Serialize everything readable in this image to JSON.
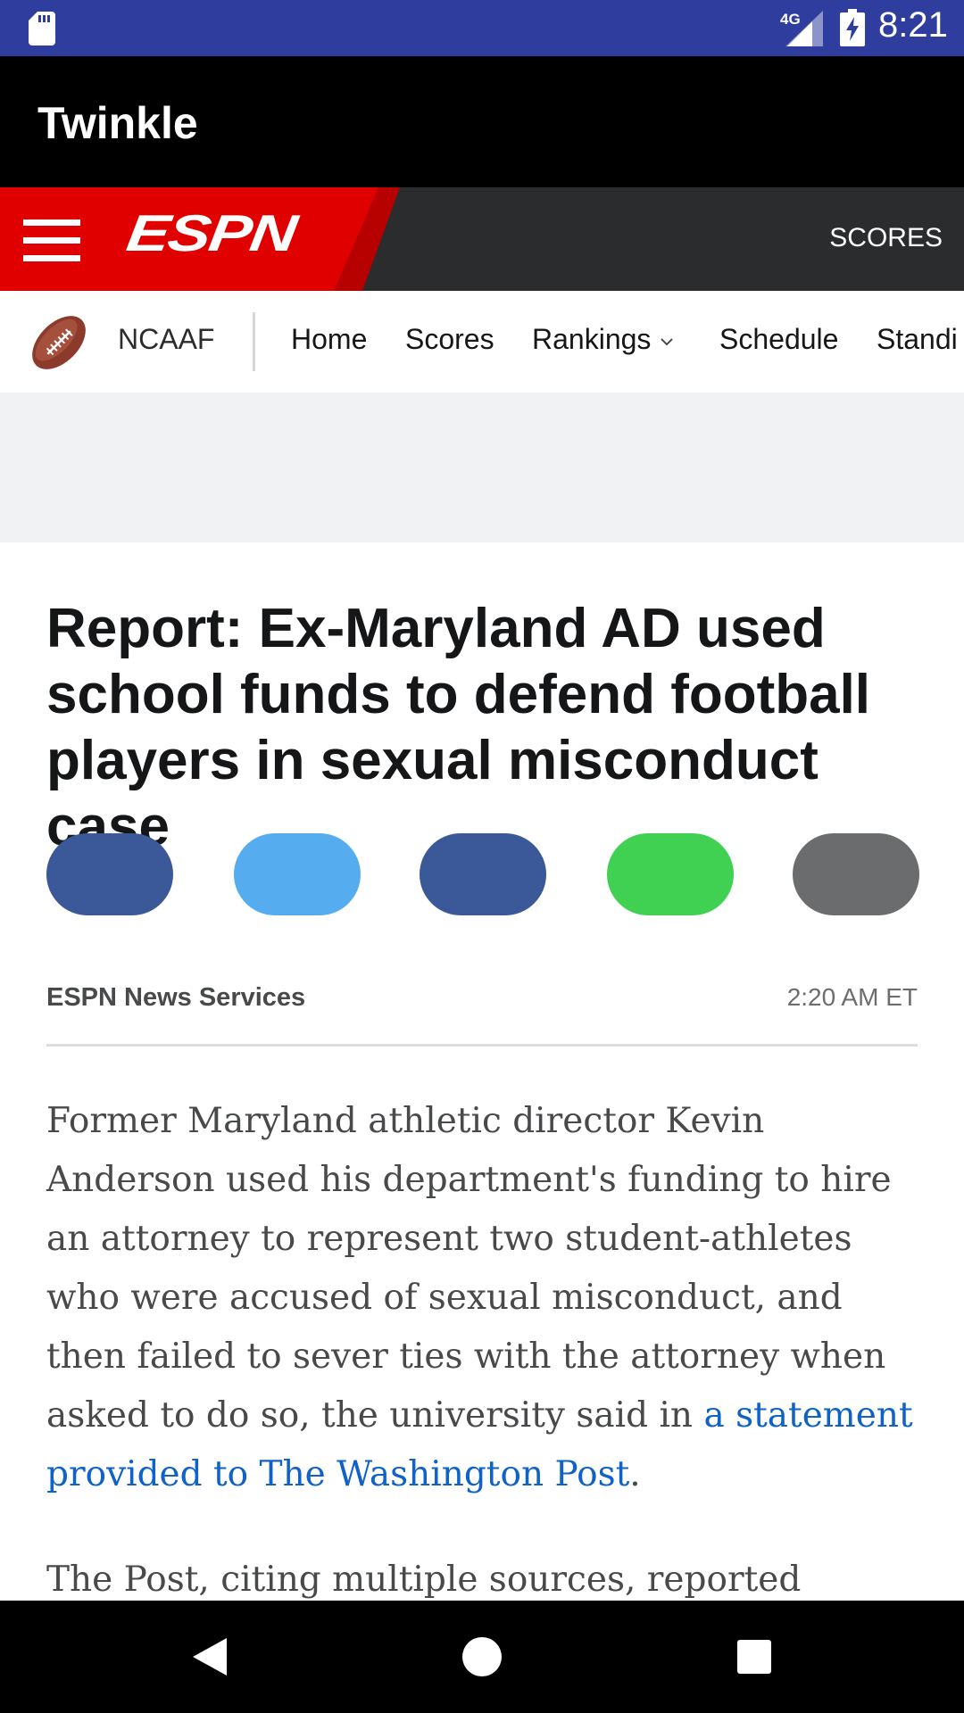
{
  "status_bar": {
    "network": "4G",
    "time": "8:21",
    "icons": [
      "sd-card-icon",
      "signal-icon",
      "battery-charging-icon"
    ]
  },
  "app_bar": {
    "title": "Twinkle"
  },
  "espn_header": {
    "logo_text": "ESPN",
    "scores_label": "SCORES",
    "colors": {
      "brand_red": "#e00000",
      "header_bg": "#2b2c2d"
    }
  },
  "sub_nav": {
    "sport": "NCAAF",
    "items": [
      {
        "label": "Home"
      },
      {
        "label": "Scores"
      },
      {
        "label": "Rankings",
        "has_dropdown": true
      },
      {
        "label": "Schedule"
      },
      {
        "label": "Standi"
      }
    ]
  },
  "article": {
    "headline": "Report: Ex-Maryland AD used school funds to defend football players in sexual misconduct case",
    "share_buttons": [
      {
        "name": "facebook",
        "color": "#3b5998"
      },
      {
        "name": "twitter",
        "color": "#55acee"
      },
      {
        "name": "messenger",
        "color": "#3b5998"
      },
      {
        "name": "sms",
        "color": "#40d152"
      },
      {
        "name": "email",
        "color": "#6b6c6e"
      }
    ],
    "byline": "ESPN News Services",
    "timestamp": "2:20 AM ET",
    "paragraph1_text": "Former Maryland athletic director Kevin Anderson used his department's funding to hire an attorney to represent two student-athletes who were accused of sexual misconduct, and then failed to sever ties with the attorney when asked to do so, the university said in ",
    "paragraph1_link": "a statement provided to The Washington Post",
    "paragraph1_end": ".",
    "paragraph2_text": "The Post, citing multiple sources, reported",
    "link_color": "#0e62c8"
  },
  "nav_bar": {
    "buttons": [
      "back-icon",
      "home-icon",
      "recents-icon"
    ]
  }
}
